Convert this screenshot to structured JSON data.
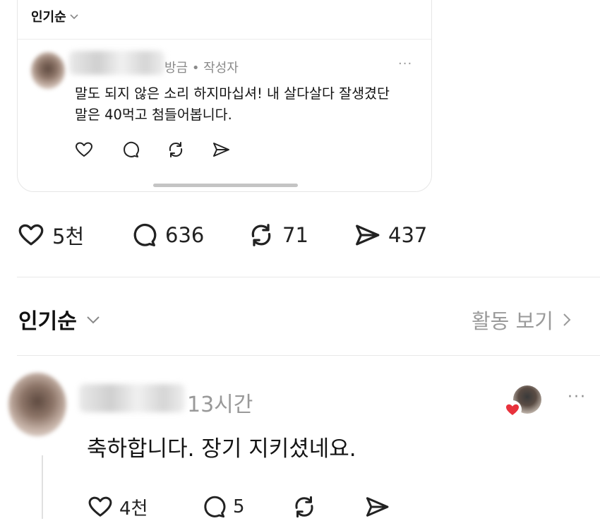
{
  "quoted_card": {
    "sort_label": "인기순",
    "reply": {
      "meta": "방금 • 작성자",
      "more": "···",
      "text_line1": "말도 되지 않은 소리 하지마십셔! 내 살다살다 잘생겼단",
      "text_line2": "말은 40먹고 첨들어봅니다."
    },
    "icons": [
      "heart-icon",
      "comment-icon",
      "repost-icon",
      "share-icon"
    ]
  },
  "post_stats": {
    "likes": "5천",
    "comments": "636",
    "reposts": "71",
    "shares": "437"
  },
  "replies_header": {
    "sort_label": "인기순",
    "activity_label": "활동 보기"
  },
  "comment": {
    "time": "13시간",
    "more": "···",
    "text": "축하합니다. 장기 지키셨네요.",
    "likes": "4천",
    "replies": "5"
  },
  "colors": {
    "heart_badge": "#e8323c",
    "muted_text": "#999999",
    "divider": "#e8e8e8"
  }
}
